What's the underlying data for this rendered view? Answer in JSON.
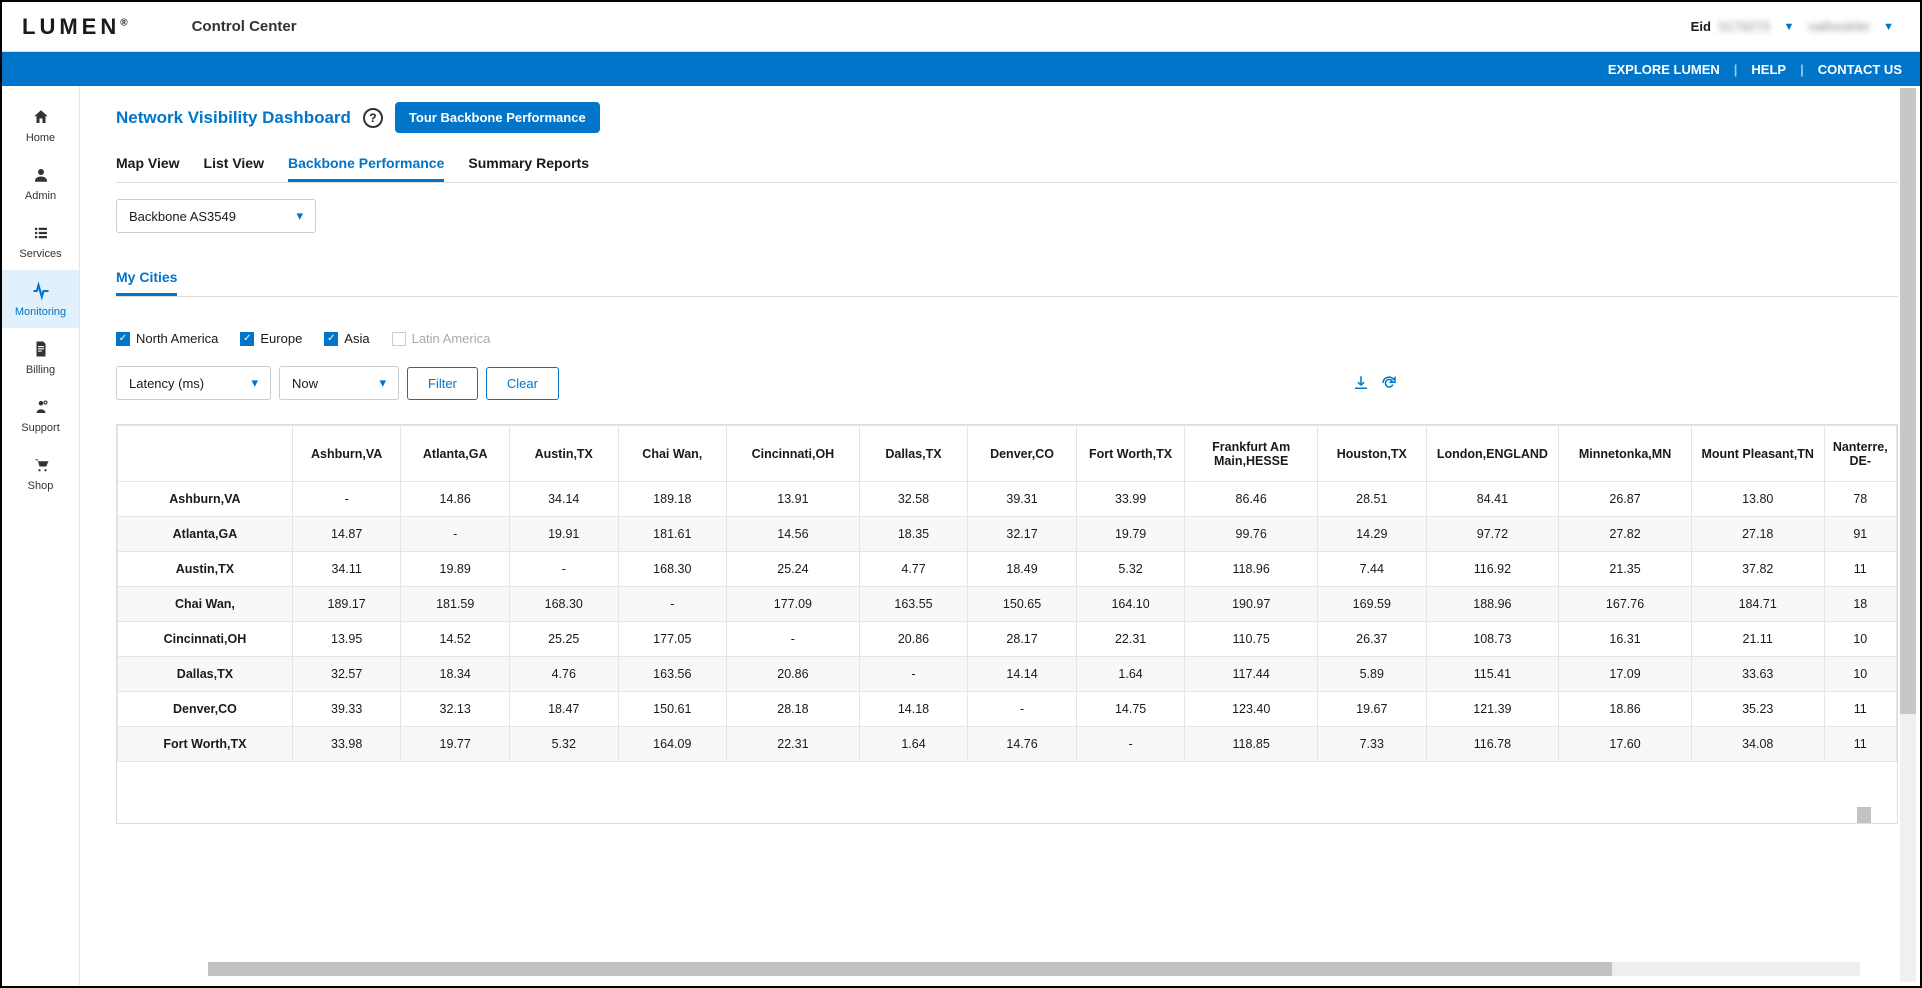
{
  "brand": "LUMEN",
  "brand_reg": "®",
  "product": "Control Center",
  "header_right": {
    "eid_label": "Eid",
    "eid_value": "0179273",
    "user": "nathostrlet"
  },
  "bluebar": {
    "explore": "EXPLORE LUMEN",
    "help": "HELP",
    "contact": "CONTACT US"
  },
  "sidebar": [
    {
      "id": "home",
      "label": "Home"
    },
    {
      "id": "admin",
      "label": "Admin"
    },
    {
      "id": "services",
      "label": "Services"
    },
    {
      "id": "monitoring",
      "label": "Monitoring",
      "active": true
    },
    {
      "id": "billing",
      "label": "Billing"
    },
    {
      "id": "support",
      "label": "Support"
    },
    {
      "id": "shop",
      "label": "Shop"
    }
  ],
  "page": {
    "title": "Network Visibility Dashboard",
    "tour_btn": "Tour Backbone Performance",
    "tabs": [
      "Map View",
      "List View",
      "Backbone Performance",
      "Summary Reports"
    ],
    "active_tab": "Backbone Performance",
    "backbone_select": "Backbone AS3549",
    "section_tab": "My Cities",
    "regions": [
      {
        "label": "North America",
        "checked": true
      },
      {
        "label": "Europe",
        "checked": true
      },
      {
        "label": "Asia",
        "checked": true
      },
      {
        "label": "Latin America",
        "checked": false
      }
    ],
    "metric_select": "Latency (ms)",
    "time_select": "Now",
    "filter_btn": "Filter",
    "clear_btn": "Clear"
  },
  "table": {
    "columns": [
      "Ashburn,VA",
      "Atlanta,GA",
      "Austin,TX",
      "Chai Wan,",
      "Cincinnati,OH",
      "Dallas,TX",
      "Denver,CO",
      "Fort Worth,TX",
      "Frankfurt Am Main,HESSE",
      "Houston,TX",
      "London,ENGLAND",
      "Minnetonka,MN",
      "Mount Pleasant,TN",
      "Nanterre, DE-"
    ],
    "rows": [
      {
        "label": "Ashburn,VA",
        "cells": [
          "-",
          "14.86",
          "34.14",
          "189.18",
          "13.91",
          "32.58",
          "39.31",
          "33.99",
          "86.46",
          "28.51",
          "84.41",
          "26.87",
          "13.80",
          "78"
        ]
      },
      {
        "label": "Atlanta,GA",
        "cells": [
          "14.87",
          "-",
          "19.91",
          "181.61",
          "14.56",
          "18.35",
          "32.17",
          "19.79",
          "99.76",
          "14.29",
          "97.72",
          "27.82",
          "27.18",
          "91"
        ]
      },
      {
        "label": "Austin,TX",
        "cells": [
          "34.11",
          "19.89",
          "-",
          "168.30",
          "25.24",
          "4.77",
          "18.49",
          "5.32",
          "118.96",
          "7.44",
          "116.92",
          "21.35",
          "37.82",
          "11"
        ]
      },
      {
        "label": "Chai Wan,",
        "cells": [
          "189.17",
          "181.59",
          "168.30",
          "-",
          "177.09",
          "163.55",
          "150.65",
          "164.10",
          "190.97",
          "169.59",
          "188.96",
          "167.76",
          "184.71",
          "18"
        ]
      },
      {
        "label": "Cincinnati,OH",
        "cells": [
          "13.95",
          "14.52",
          "25.25",
          "177.05",
          "-",
          "20.86",
          "28.17",
          "22.31",
          "110.75",
          "26.37",
          "108.73",
          "16.31",
          "21.11",
          "10"
        ]
      },
      {
        "label": "Dallas,TX",
        "cells": [
          "32.57",
          "18.34",
          "4.76",
          "163.56",
          "20.86",
          "-",
          "14.14",
          "1.64",
          "117.44",
          "5.89",
          "115.41",
          "17.09",
          "33.63",
          "10"
        ]
      },
      {
        "label": "Denver,CO",
        "cells": [
          "39.33",
          "32.13",
          "18.47",
          "150.61",
          "28.18",
          "14.18",
          "-",
          "14.75",
          "123.40",
          "19.67",
          "121.39",
          "18.86",
          "35.23",
          "11"
        ]
      },
      {
        "label": "Fort Worth,TX",
        "cells": [
          "33.98",
          "19.77",
          "5.32",
          "164.09",
          "22.31",
          "1.64",
          "14.76",
          "-",
          "118.85",
          "7.33",
          "116.78",
          "17.60",
          "34.08",
          "11"
        ]
      }
    ]
  }
}
